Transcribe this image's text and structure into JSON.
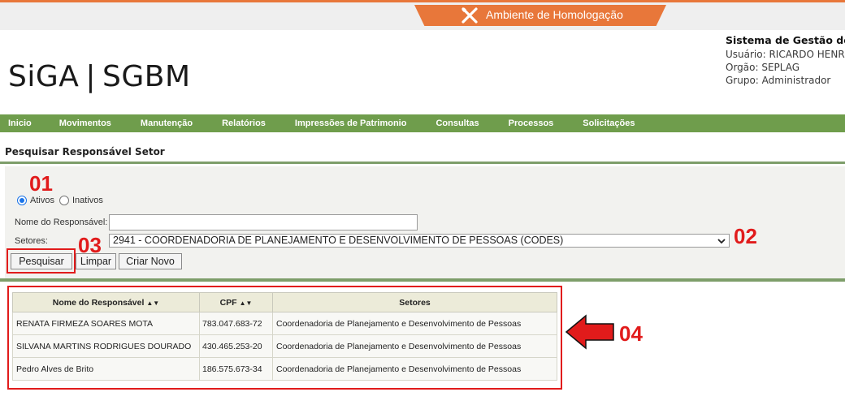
{
  "environment": {
    "label": "Ambiente de Homologação",
    "accent": "#e8773a",
    "icon": "tools-icon"
  },
  "header": {
    "logo_left": "SiGA",
    "logo_separator": "|",
    "logo_right": "SGBM",
    "system_title": "Sistema de Gestão de",
    "user": "Usuário: RICARDO HENR",
    "orgao": "Orgão: SEPLAG",
    "grupo": "Grupo: Administrador"
  },
  "nav": {
    "color": "#6f9d4c",
    "items": [
      "Inicio",
      "Movimentos",
      "Manutenção",
      "Relatórios",
      "Impressões de Patrimonio",
      "Consultas",
      "Processos",
      "Solicitações"
    ]
  },
  "page": {
    "title": "Pesquisar Responsável Setor"
  },
  "form": {
    "status_options": [
      {
        "label": "Ativos",
        "selected": true
      },
      {
        "label": "Inativos",
        "selected": false
      }
    ],
    "responsavel_label": "Nome do Responsável:",
    "responsavel_value": "",
    "setores_label": "Setores:",
    "setores_selected": "2941 - COORDENADORIA DE PLANEJAMENTO E DESENVOLVIMENTO DE PESSOAS (CODES)",
    "buttons": {
      "search": "Pesquisar",
      "clear": "Limpar",
      "new": "Criar Novo"
    }
  },
  "table": {
    "columns": [
      {
        "label": "Nome do Responsável",
        "sortable": true
      },
      {
        "label": "CPF",
        "sortable": true
      },
      {
        "label": "Setores",
        "sortable": false
      }
    ],
    "rows": [
      [
        "RENATA FIRMEZA SOARES MOTA",
        "783.047.683-72",
        "Coordenadoria de Planejamento e Desenvolvimento de Pessoas"
      ],
      [
        "SILVANA MARTINS RODRIGUES DOURADO",
        "430.465.253-20",
        "Coordenadoria de Planejamento e Desenvolvimento de Pessoas"
      ],
      [
        "Pedro Alves de Brito",
        "186.575.673-34",
        "Coordenadoria de Planejamento e Desenvolvimento de Pessoas"
      ]
    ]
  },
  "annotations": {
    "color": "#e11b1b",
    "step1": "01",
    "step2": "02",
    "step3": "03",
    "step4": "04"
  }
}
